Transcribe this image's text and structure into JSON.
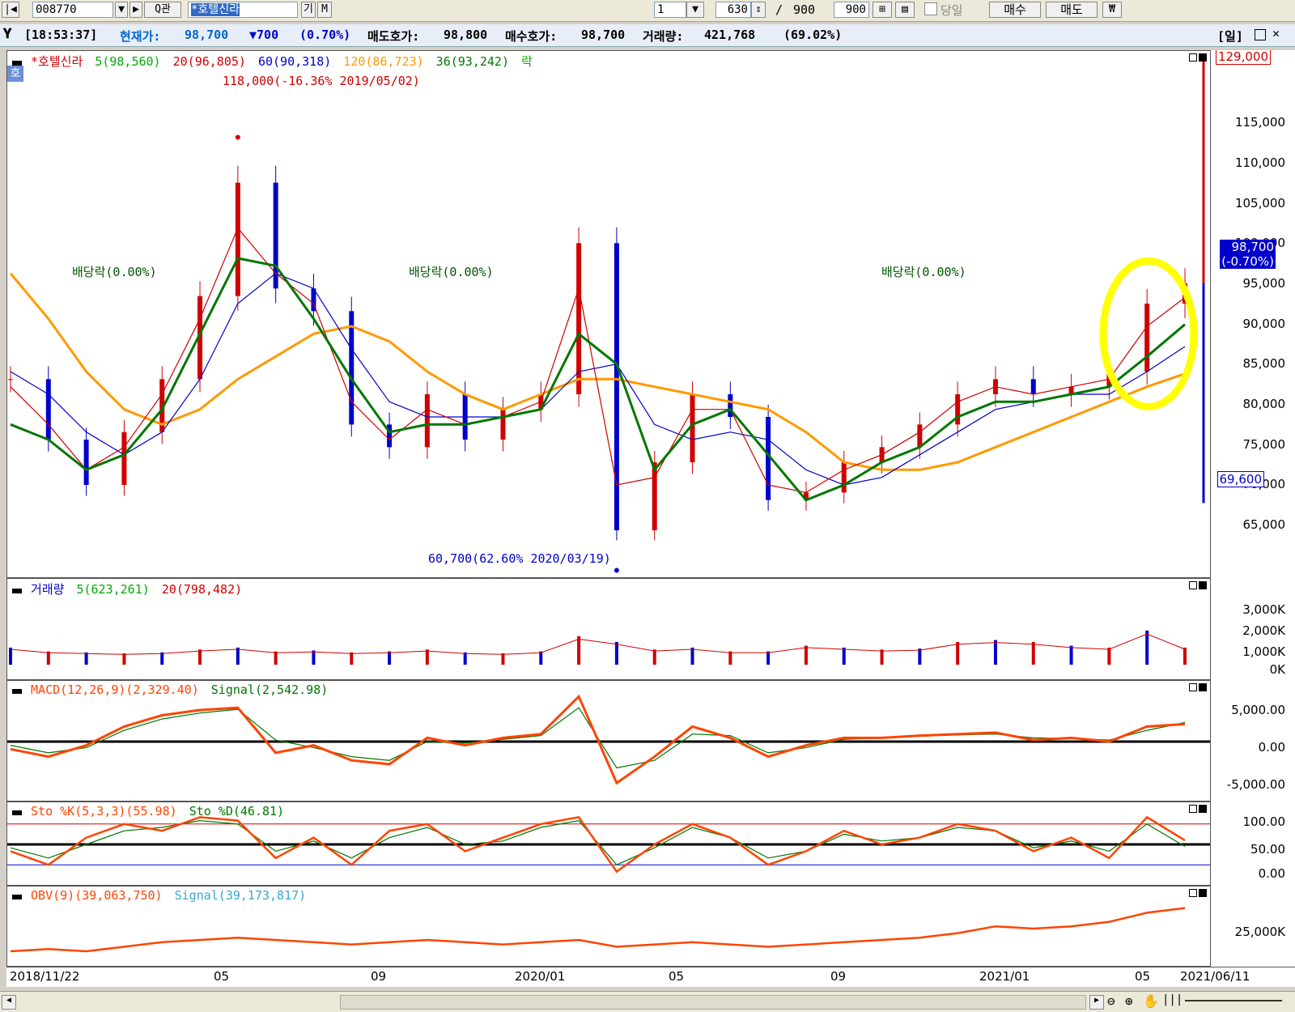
{
  "toolbar": {
    "code": "008770",
    "btn_search": "Q관",
    "name": "*호텔신라",
    "btn_gi": "기",
    "btn_m": "M",
    "count_select": "1",
    "range_value": "630",
    "range_sep": "/",
    "range_total": "900",
    "range_total2": "900",
    "today_checkbox": "당일",
    "buy_button": "매수",
    "sell_button": "매도",
    "won_button": "₩"
  },
  "infobar": {
    "time": "[18:53:37]",
    "price_label": "현재가:",
    "price": "98,700",
    "change": "▼700",
    "change_pct": "(0.70%)",
    "ask_label": "매도호가:",
    "ask": "98,800",
    "bid_label": "매수호가:",
    "bid": "98,700",
    "volume_label": "거래량:",
    "volume": "421,768",
    "volume_pct": "(69.02%)",
    "period": "[일]"
  },
  "price_panel": {
    "badge": "호",
    "legend": [
      "*호텔신라",
      "5(98,560)",
      "20(96,805)",
      "60(90,318)",
      "120(86,723)",
      "36(93,242)",
      "락"
    ],
    "legend_colors": [
      "#d00000",
      "#00aa00",
      "#d00000",
      "#0000cc",
      "#ff9900",
      "#007700",
      "#00aa00"
    ],
    "high_label": "118,000(-16.36% 2019/05/02)",
    "low_label": "60,700(62.60% 2020/03/19)",
    "dividend_label": "배당락(0.00%)",
    "axis_labels": [
      "115,000",
      "110,000",
      "105,000",
      "100,000",
      "95,000",
      "90,000",
      "85,000",
      "80,000",
      "75,000",
      "70,000",
      "65,000"
    ],
    "axis_top": "129,000",
    "axis_bottom": "69,600",
    "current_price": "98,700",
    "current_change": "(-0.70%)"
  },
  "volume_panel": {
    "legend": [
      "거래량",
      "5(623,261)",
      "20(798,482)"
    ],
    "axis_labels": [
      "3,000K",
      "2,000K",
      "1,000K",
      "0K"
    ]
  },
  "macd_panel": {
    "legend": [
      "MACD(12,26,9)(2,329.40)",
      "Signal(2,542.98)"
    ],
    "axis_labels": [
      "5,000.00",
      "0.00",
      "-5,000.00"
    ]
  },
  "sto_panel": {
    "legend": [
      "Sto %K(5,3,3)(55.98)",
      "Sto %D(46.81)"
    ],
    "axis_labels": [
      "100.00",
      "50.00",
      "0.00"
    ]
  },
  "obv_panel": {
    "legend": [
      "OBV(9)(39,063,750)",
      "Signal(39,173,817)"
    ],
    "axis_labels": [
      "25,000K"
    ]
  },
  "date_axis": [
    "2018/11/22",
    "05",
    "09",
    "2020/01",
    "05",
    "09",
    "2021/01",
    "05",
    "2021/06/11"
  ],
  "chart_data": {
    "type": "line",
    "title": "*호텔신라",
    "x": [
      "2018/11/22",
      "2018/12",
      "2019/01",
      "2019/02",
      "2019/03",
      "2019/04",
      "2019/05",
      "2019/06",
      "2019/07",
      "2019/08",
      "2019/09",
      "2019/10",
      "2019/11",
      "2019/12",
      "2020/01",
      "2020/02",
      "2020/03",
      "2020/04",
      "2020/05",
      "2020/06",
      "2020/07",
      "2020/08",
      "2020/09",
      "2020/10",
      "2020/11",
      "2020/12",
      "2021/01",
      "2021/02",
      "2021/03",
      "2021/04",
      "2021/05",
      "2021/06/11"
    ],
    "series": [
      {
        "name": "*호텔신라",
        "values": [
          86000,
          78000,
          72000,
          79000,
          86000,
          97000,
          112000,
          98000,
          95000,
          80000,
          77000,
          84000,
          78000,
          82000,
          84000,
          104000,
          66000,
          75000,
          84000,
          81000,
          70000,
          71000,
          75000,
          77000,
          80000,
          84000,
          86000,
          84000,
          85000,
          87000,
          96000,
          98700
        ]
      },
      {
        "name": "20(96,805)",
        "values": [
          85000,
          80000,
          74000,
          77000,
          84000,
          94000,
          106000,
          100000,
          96000,
          83000,
          78000,
          82000,
          80000,
          81000,
          83000,
          98000,
          72000,
          73000,
          82000,
          82000,
          72000,
          71000,
          74000,
          76000,
          79000,
          83000,
          85000,
          84000,
          85000,
          86000,
          93000,
          96805
        ]
      },
      {
        "name": "60(90,318)",
        "values": [
          87000,
          84000,
          79000,
          76000,
          79000,
          86000,
          96000,
          100000,
          98000,
          90000,
          83000,
          81000,
          81000,
          81000,
          82000,
          87000,
          88000,
          80000,
          78000,
          79000,
          78000,
          74000,
          72000,
          73000,
          76000,
          79000,
          82000,
          83000,
          84000,
          84000,
          87000,
          90318
        ]
      },
      {
        "name": "120(86,723)",
        "values": [
          100000,
          94000,
          87000,
          82000,
          80000,
          82000,
          86000,
          89000,
          92000,
          93000,
          91000,
          87000,
          84000,
          82000,
          84000,
          86000,
          86000,
          85000,
          84000,
          83000,
          82000,
          79000,
          75000,
          74000,
          74000,
          75000,
          77000,
          79000,
          81000,
          83000,
          85000,
          86723
        ]
      },
      {
        "name": "36(93,242)",
        "values": [
          80000,
          78000,
          74000,
          76000,
          82000,
          92000,
          102000,
          101000,
          94000,
          86000,
          79000,
          80000,
          80000,
          81000,
          82000,
          92000,
          88000,
          74000,
          80000,
          82000,
          76000,
          70000,
          72000,
          75000,
          77000,
          81000,
          83000,
          83000,
          84000,
          85000,
          89000,
          93242
        ]
      }
    ],
    "ylim": [
      60000,
      129000
    ],
    "high": {
      "value": 118000,
      "date": "2019/05/02"
    },
    "low": {
      "value": 60700,
      "date": "2020/03/19"
    },
    "volume": [
      900000,
      700000,
      650000,
      600000,
      650000,
      800000,
      900000,
      700000,
      750000,
      650000,
      700000,
      800000,
      650000,
      600000,
      700000,
      1500000,
      1200000,
      800000,
      900000,
      700000,
      700000,
      1000000,
      900000,
      800000,
      850000,
      1200000,
      1300000,
      1200000,
      1000000,
      900000,
      1800000,
      900000
    ],
    "macd": [
      -1000,
      -2000,
      -500,
      2000,
      3500,
      4200,
      4500,
      -1500,
      -500,
      -2500,
      -3000,
      500,
      -500,
      500,
      1000,
      6000,
      -5500,
      -2000,
      2000,
      500,
      -2000,
      -500,
      500,
      500,
      800,
      1000,
      1200,
      200,
      500,
      0,
      2000,
      2329
    ],
    "macd_signal": [
      -500,
      -1500,
      -800,
      1500,
      3000,
      3800,
      4300,
      200,
      -800,
      -2000,
      -2500,
      0,
      -200,
      300,
      800,
      4500,
      -3500,
      -2500,
      1000,
      800,
      -1500,
      -800,
      300,
      500,
      700,
      900,
      1000,
      500,
      400,
      200,
      1500,
      2543
    ],
    "sto_k": [
      40,
      20,
      60,
      80,
      70,
      90,
      85,
      30,
      60,
      20,
      70,
      80,
      40,
      60,
      80,
      90,
      10,
      50,
      80,
      60,
      20,
      40,
      70,
      50,
      60,
      80,
      70,
      40,
      60,
      30,
      90,
      56
    ],
    "sto_d": [
      45,
      30,
      50,
      70,
      75,
      85,
      80,
      40,
      55,
      30,
      60,
      75,
      50,
      55,
      75,
      85,
      20,
      45,
      75,
      60,
      30,
      40,
      65,
      55,
      60,
      75,
      70,
      45,
      55,
      40,
      80,
      47
    ],
    "obv_ylim": [
      15000,
      45000
    ],
    "obv": [
      20000,
      21000,
      20000,
      22000,
      24000,
      25000,
      26000,
      25000,
      24000,
      23000,
      24000,
      25000,
      24000,
      23000,
      24000,
      25000,
      22000,
      23000,
      24000,
      23000,
      22000,
      23000,
      24000,
      25000,
      26000,
      28000,
      31000,
      30000,
      31000,
      33000,
      37000,
      39064
    ]
  }
}
